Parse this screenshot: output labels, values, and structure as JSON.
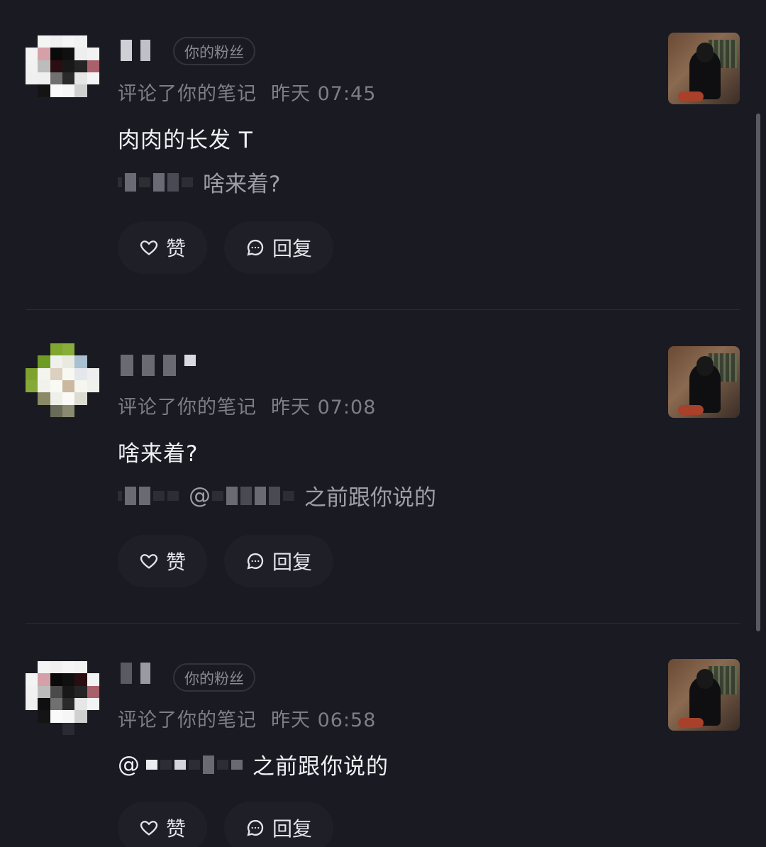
{
  "items": [
    {
      "badge": "你的粉丝",
      "action": "评论了你的笔记",
      "time": "昨天 07:45",
      "text": "肉肉的长发 T",
      "quote_text": "啥来着?",
      "like_label": "赞",
      "reply_label": "回复"
    },
    {
      "badge": "",
      "action": "评论了你的笔记",
      "time": "昨天 07:08",
      "text": "啥来着?",
      "quote_text": "之前跟你说的",
      "quote_at": "@",
      "like_label": "赞",
      "reply_label": "回复"
    },
    {
      "badge": "你的粉丝",
      "action": "评论了你的笔记",
      "time": "昨天 06:58",
      "text_at": "@",
      "text": "之前跟你说的",
      "like_label": "赞",
      "reply_label": "回复"
    }
  ],
  "icons": {
    "like": "heart-icon",
    "reply": "chat-bubble-icon"
  }
}
